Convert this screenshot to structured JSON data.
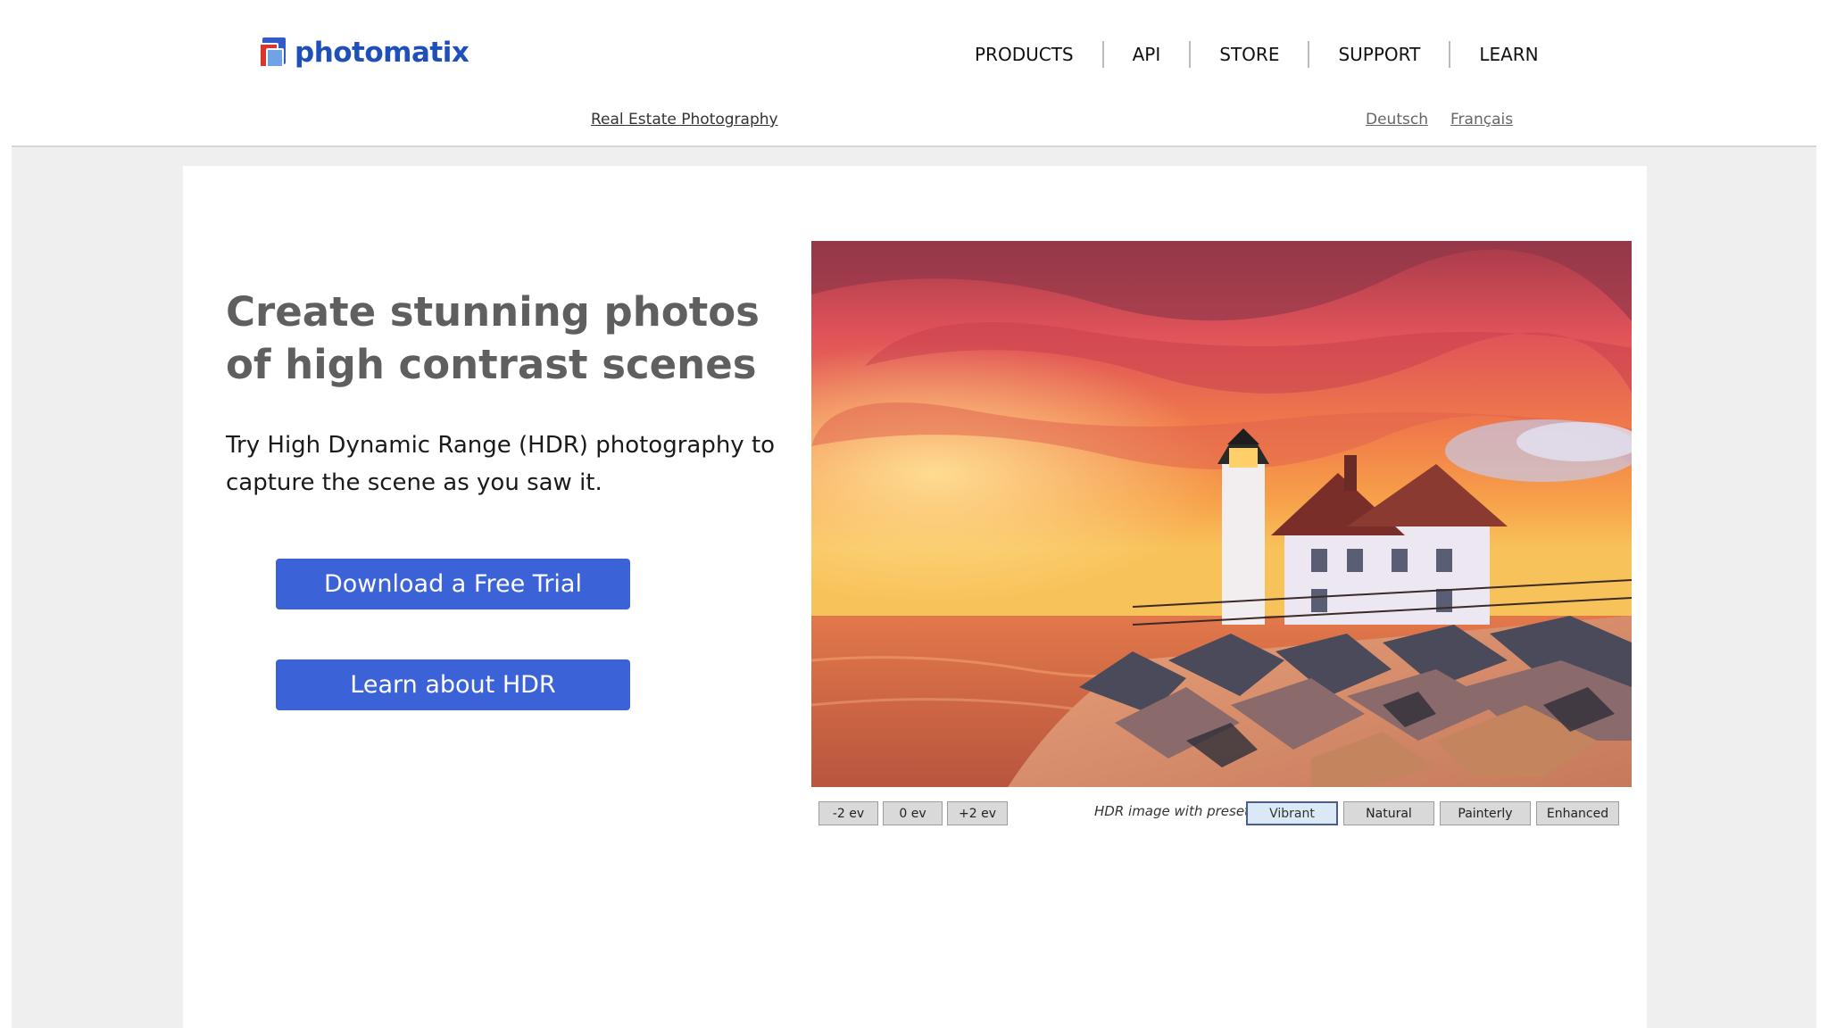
{
  "header": {
    "logo_text": "photomatix",
    "nav": [
      "PRODUCTS",
      "API",
      "STORE",
      "SUPPORT",
      "LEARN"
    ],
    "subnav_link": "Real Estate Photography",
    "languages": [
      "Deutsch",
      "Français"
    ]
  },
  "hero": {
    "headline_line1": "Create stunning photos",
    "headline_line2": "of high contrast scenes",
    "lead_line1": "Try High Dynamic Range (HDR) photography to",
    "lead_line2": "capture the scene as you saw it.",
    "download_button": "Download a Free Trial",
    "learn_button": "Learn about HDR"
  },
  "viewer": {
    "ev_buttons": [
      "-2 ev",
      "0 ev",
      "+2 ev"
    ],
    "preset_label": "HDR image with preset:",
    "presets": [
      "Vibrant",
      "Natural",
      "Painterly",
      "Enhanced"
    ],
    "active_preset": "Vibrant"
  },
  "colors": {
    "brand_blue": "#1f4fb8",
    "button_blue": "#3c62d8",
    "headline_gray": "#5f5f5f"
  }
}
